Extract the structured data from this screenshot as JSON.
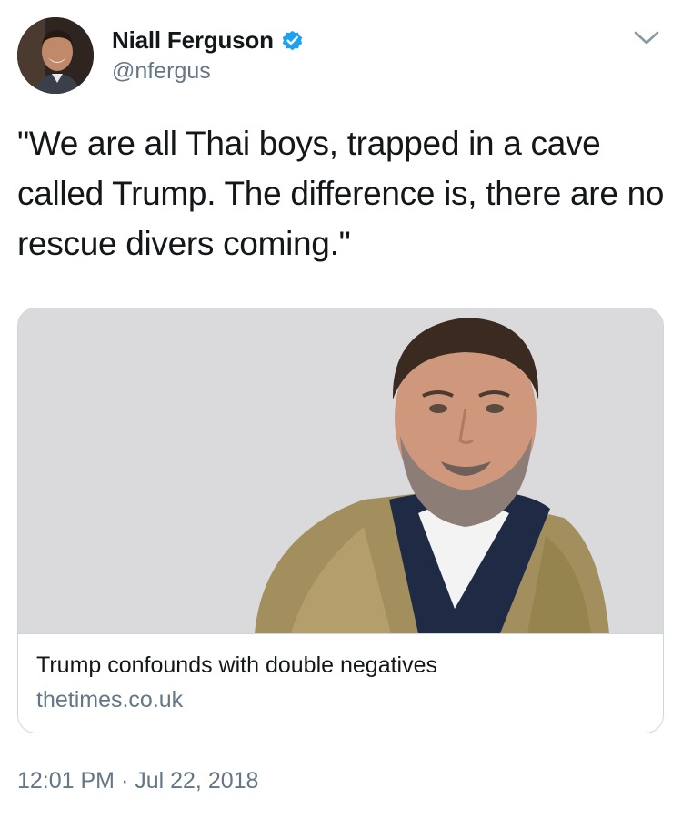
{
  "tweet": {
    "author": {
      "display_name": "Niall Ferguson",
      "handle": "@nfergus",
      "verified": true,
      "avatar_icon": "profile-photo"
    },
    "menu_icon": "chevron-down-icon",
    "text": "\"We are all Thai boys, trapped in a cave called Trump. The difference is, there are no rescue divers coming.\"",
    "card": {
      "image_icon": "author-portrait-photo",
      "title": "Trump confounds with double negatives",
      "domain": "thetimes.co.uk"
    },
    "timestamp": "12:01 PM · Jul 22, 2018"
  },
  "colors": {
    "text_primary": "#14171a",
    "text_secondary": "#657786",
    "verified_blue": "#1da1f2",
    "border": "#ccd6dd",
    "card_image_bg": "#dadadc"
  }
}
